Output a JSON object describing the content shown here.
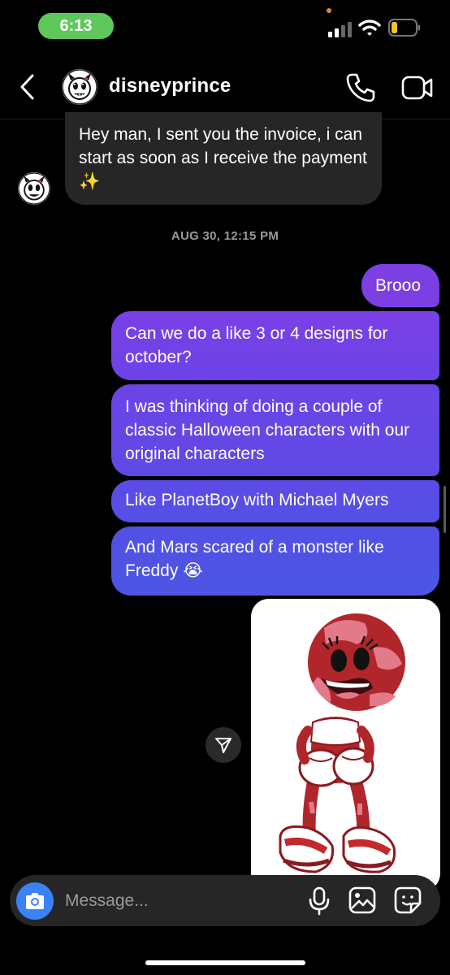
{
  "status_bar": {
    "time": "6:13"
  },
  "header": {
    "contact_name": "disneyprince",
    "back_icon": "chevron-left-icon",
    "call_icon": "phone-icon",
    "video_icon": "video-camera-icon"
  },
  "messages": {
    "incoming_1": "Hey man, I sent you the invoice, i can start as soon as I receive the payment ✨",
    "timestamp": "AUG 30, 12:15 PM",
    "outgoing": [
      "Brooo",
      "Can we do a like 3 or 4 designs for october?",
      "I was thinking of doing a couple of classic Halloween characters with our original characters",
      "Like PlanetBoy with Michael Myers",
      "And Mars scared of a monster like Freddy 😭"
    ],
    "outgoing_gradient_colors": [
      "#7b3fe4",
      "#4c55e4"
    ]
  },
  "composer": {
    "placeholder": "Message...",
    "camera_icon": "camera-icon",
    "mic_icon": "microphone-icon",
    "gallery_icon": "gallery-icon",
    "sticker_icon": "sticker-icon",
    "camera_button_color": "#3b82f6"
  }
}
